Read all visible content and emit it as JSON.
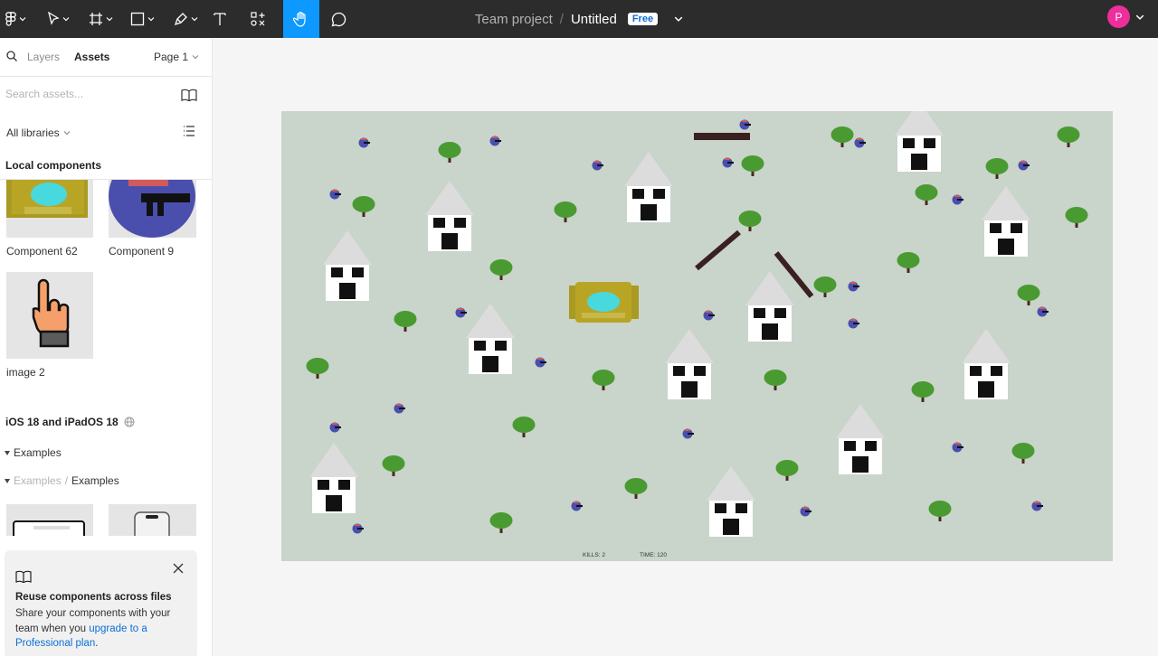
{
  "toolbar": {
    "tools": [
      "figma-menu",
      "move-tool",
      "frame-tool",
      "shape-tool",
      "pen-tool",
      "text-tool",
      "components-tool",
      "hand-tool",
      "comment-tool"
    ],
    "active_tool": "hand-tool"
  },
  "breadcrumb": {
    "team": "Team project",
    "separator": "/",
    "file": "Untitled",
    "plan_badge": "Free"
  },
  "user": {
    "initial": "P",
    "color": "#ee2e9a"
  },
  "sidebar": {
    "tabs": {
      "layers": "Layers",
      "assets": "Assets",
      "page": "Page 1"
    },
    "search": {
      "placeholder": "Search assets..."
    },
    "library_filter": "All libraries",
    "local_components_title": "Local components",
    "components": [
      {
        "label": "Component 62"
      },
      {
        "label": "Component 9"
      },
      {
        "label": "image 2"
      }
    ],
    "ios_library": "iOS 18 and iPadOS 18",
    "examples_group": "Examples",
    "examples_path_muted": "Examples",
    "examples_path_sep": "/",
    "examples_path": "Examples"
  },
  "promo": {
    "heading": "Reuse components across files",
    "body": "Share your components with your team when you ",
    "link": "upgrade to a Professional plan",
    "tail": "."
  },
  "game": {
    "background": "#c9d4cb",
    "kills_label": "KILLS: 2",
    "time_label": "TIME: 120"
  }
}
